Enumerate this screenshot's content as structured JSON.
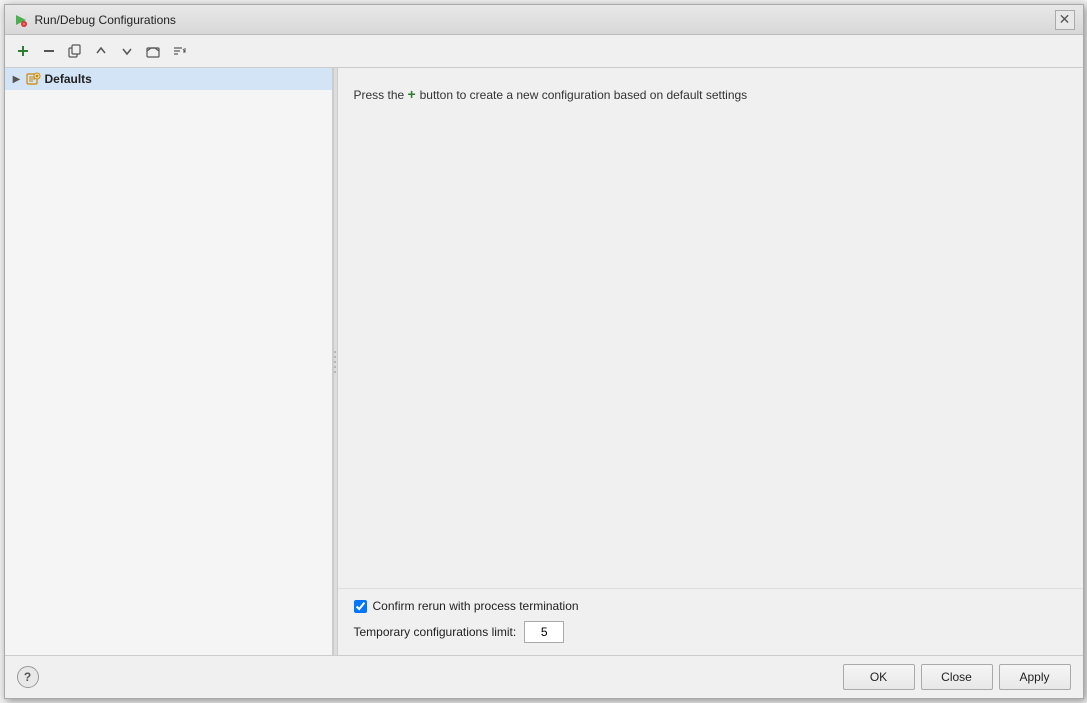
{
  "titleBar": {
    "title": "Run/Debug Configurations",
    "closeLabel": "✕"
  },
  "toolbar": {
    "addLabel": "+",
    "removeLabel": "−",
    "copyLabel": "⧉",
    "moveUpLabel": "↑",
    "moveDownLabel": "↓",
    "folderLabel": "📁",
    "sortLabel": "⇅"
  },
  "tree": {
    "items": [
      {
        "label": "Defaults",
        "level": 0,
        "hasArrow": true,
        "selected": true
      }
    ]
  },
  "hint": {
    "prefix": "Press the",
    "middle": " button to create a new configuration based on default settings",
    "plusSymbol": "+"
  },
  "options": {
    "confirmRerun": {
      "label": "Confirm rerun with process termination",
      "checked": true
    },
    "tempLimit": {
      "label": "Temporary configurations limit:",
      "value": "5"
    }
  },
  "footer": {
    "helpTooltip": "?",
    "okLabel": "OK",
    "closeLabel": "Close",
    "applyLabel": "Apply"
  }
}
